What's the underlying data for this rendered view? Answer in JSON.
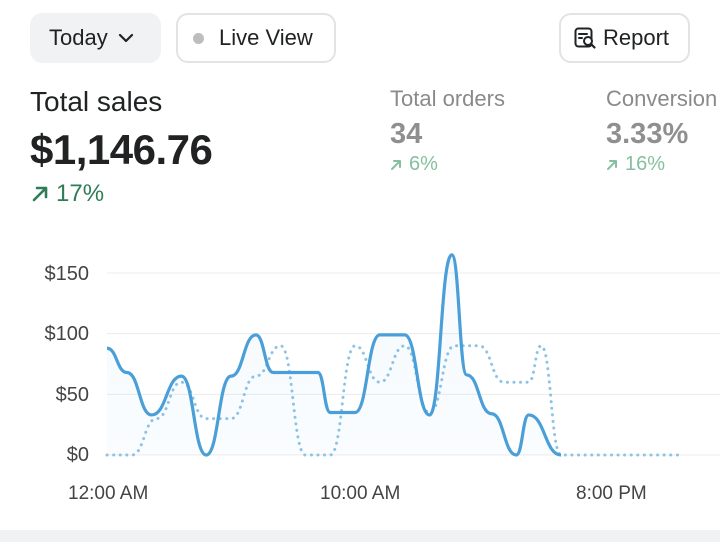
{
  "toolbar": {
    "date_label": "Today",
    "live_label": "Live View",
    "report_label": "Report"
  },
  "metrics": {
    "total_sales": {
      "label": "Total sales",
      "value": "$1,146.76",
      "delta": "17%"
    },
    "total_orders": {
      "label": "Total orders",
      "value": "34",
      "delta": "6%"
    },
    "conversion": {
      "label": "Conversion",
      "value": "3.33%",
      "delta": "16%"
    }
  },
  "colors": {
    "series_today": "#4a9fd8",
    "series_compare": "#8dc4e6",
    "delta_positive": "#2e7d57",
    "delta_positive_muted": "#86bfa0"
  },
  "icons": {
    "date_dropdown": "chevron-down-icon",
    "live": "status-dot-icon",
    "report": "report-search-icon",
    "delta": "arrow-up-right-icon"
  },
  "chart_data": {
    "type": "line",
    "ylim": [
      0,
      165
    ],
    "y_ticks": [
      "$150",
      "$100",
      "$50",
      "$0"
    ],
    "y_tick_values": [
      150,
      100,
      50,
      0
    ],
    "x_ticks": [
      "12:00 AM",
      "10:00 AM",
      "8:00 PM"
    ],
    "x_tick_hours": [
      0,
      10,
      20
    ],
    "xlim": [
      0,
      23
    ],
    "series": [
      {
        "style": "solid",
        "x": [
          0,
          0.8,
          1.8,
          3,
          4,
          5,
          6,
          6.7,
          7.5,
          8.5,
          9,
          10,
          11,
          12,
          13,
          13.9,
          14.5,
          15.5,
          16.5,
          17,
          18.3
        ],
        "values": [
          88,
          68,
          33,
          65,
          0,
          65,
          99,
          68,
          68,
          68,
          35,
          35,
          99,
          99,
          33,
          165,
          66,
          34,
          0,
          33,
          0
        ]
      },
      {
        "style": "dotted",
        "x": [
          0,
          1,
          2,
          3,
          4,
          5,
          6,
          7,
          8,
          9,
          10,
          11,
          12,
          13,
          14,
          15,
          16,
          17,
          17.5,
          18.3,
          23
        ],
        "values": [
          0,
          0,
          30,
          60,
          30,
          30,
          65,
          90,
          0,
          0,
          90,
          60,
          90,
          35,
          90,
          90,
          60,
          60,
          90,
          0,
          0
        ]
      }
    ]
  }
}
